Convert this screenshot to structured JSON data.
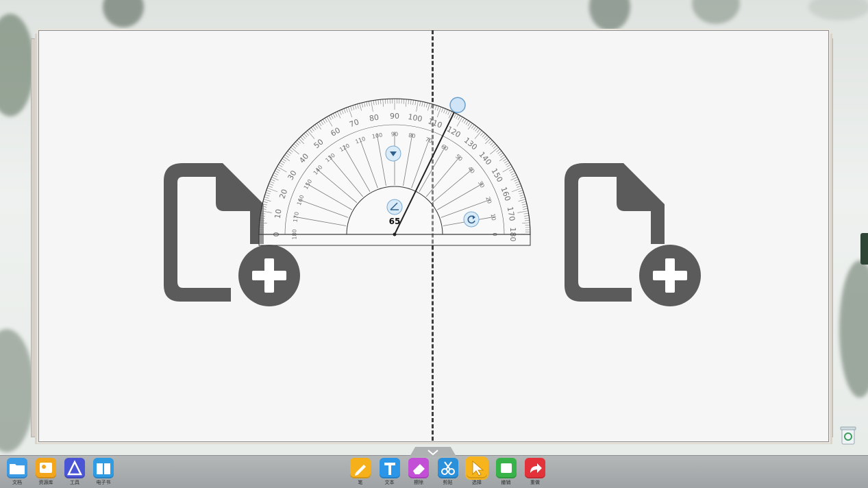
{
  "board": {
    "divider": "dashed"
  },
  "pages": [
    {
      "name": "left",
      "action_icon": "add-document-icon"
    },
    {
      "name": "right",
      "action_icon": "add-document-icon"
    }
  ],
  "protractor": {
    "outer_labels": [
      "0",
      "10",
      "20",
      "30",
      "40",
      "50",
      "60",
      "70",
      "80",
      "90",
      "100",
      "110",
      "120",
      "130",
      "140",
      "150",
      "160",
      "170",
      "180"
    ],
    "inner_labels": [
      "0",
      "10",
      "20",
      "30",
      "40",
      "50",
      "60",
      "70",
      "80",
      "90",
      "100",
      "110",
      "120",
      "130",
      "140",
      "150",
      "160",
      "170",
      "180"
    ],
    "pointer_angle_deg": 64,
    "center_readout": "65"
  },
  "toolbar": {
    "left": [
      {
        "name": "documents",
        "icon": "folder-icon",
        "label": "文档",
        "color": "#3b9be6"
      },
      {
        "name": "courseware",
        "icon": "courseware-icon",
        "label": "资源库",
        "color": "#f3a51c"
      },
      {
        "name": "tools",
        "icon": "triangle-ruler-icon",
        "label": "工具",
        "color": "#4a55d6"
      },
      {
        "name": "ebook",
        "icon": "book-icon",
        "label": "电子书",
        "color": "#2f9be2"
      }
    ],
    "center": [
      {
        "name": "pen",
        "icon": "pen-icon",
        "label": "笔",
        "color": "#f6b11a"
      },
      {
        "name": "text",
        "icon": "text-icon",
        "label": "文本",
        "color": "#2b96e8"
      },
      {
        "name": "eraser",
        "icon": "eraser-icon",
        "label": "擦除",
        "color": "#c24fd6"
      },
      {
        "name": "clip",
        "icon": "scissors-icon",
        "label": "剪贴",
        "color": "#2a90d9"
      },
      {
        "name": "select",
        "icon": "cursor-icon",
        "label": "选择",
        "color": "#f7b41d",
        "active": true
      },
      {
        "name": "undo",
        "icon": "undo-icon",
        "label": "撤销",
        "color": "#37b34a"
      },
      {
        "name": "redo",
        "icon": "redo-icon",
        "label": "重做",
        "color": "#e4323b"
      }
    ]
  }
}
